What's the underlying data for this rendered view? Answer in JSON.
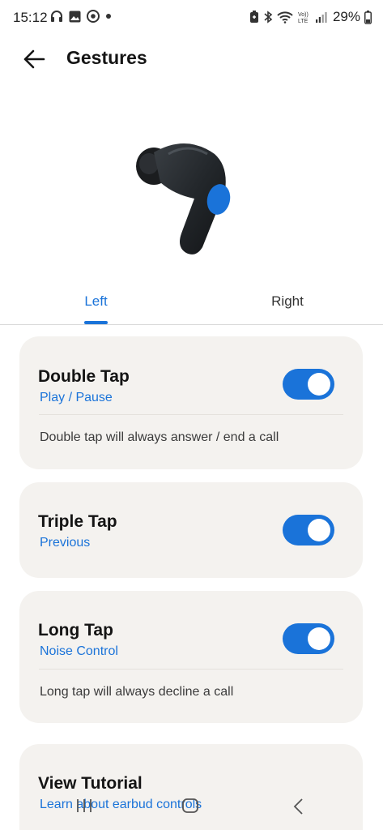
{
  "status_bar": {
    "time": "15:12",
    "battery": "29%",
    "icons_left": [
      "headphones-icon",
      "gallery-icon",
      "chrome-icon",
      "dot-icon"
    ],
    "icons_right": [
      "battery-saver-icon",
      "bluetooth-icon",
      "wifi-icon",
      "volte-icon",
      "signal-icon"
    ]
  },
  "header": {
    "title": "Gestures"
  },
  "tabs": [
    {
      "label": "Left",
      "selected": true
    },
    {
      "label": "Right",
      "selected": false
    }
  ],
  "gestures": [
    {
      "title": "Double Tap",
      "action": "Play / Pause",
      "note": "Double tap will always answer / end a call",
      "enabled": true
    },
    {
      "title": "Triple Tap",
      "action": "Previous",
      "enabled": true
    },
    {
      "title": "Long Tap",
      "action": "Noise Control",
      "note": "Long tap will always decline a call",
      "enabled": true
    }
  ],
  "tutorial": {
    "title": "View Tutorial",
    "subtitle": "Learn about earbud controls"
  },
  "colors": {
    "accent": "#1a73d9",
    "card_bg": "#f4f2ef"
  }
}
